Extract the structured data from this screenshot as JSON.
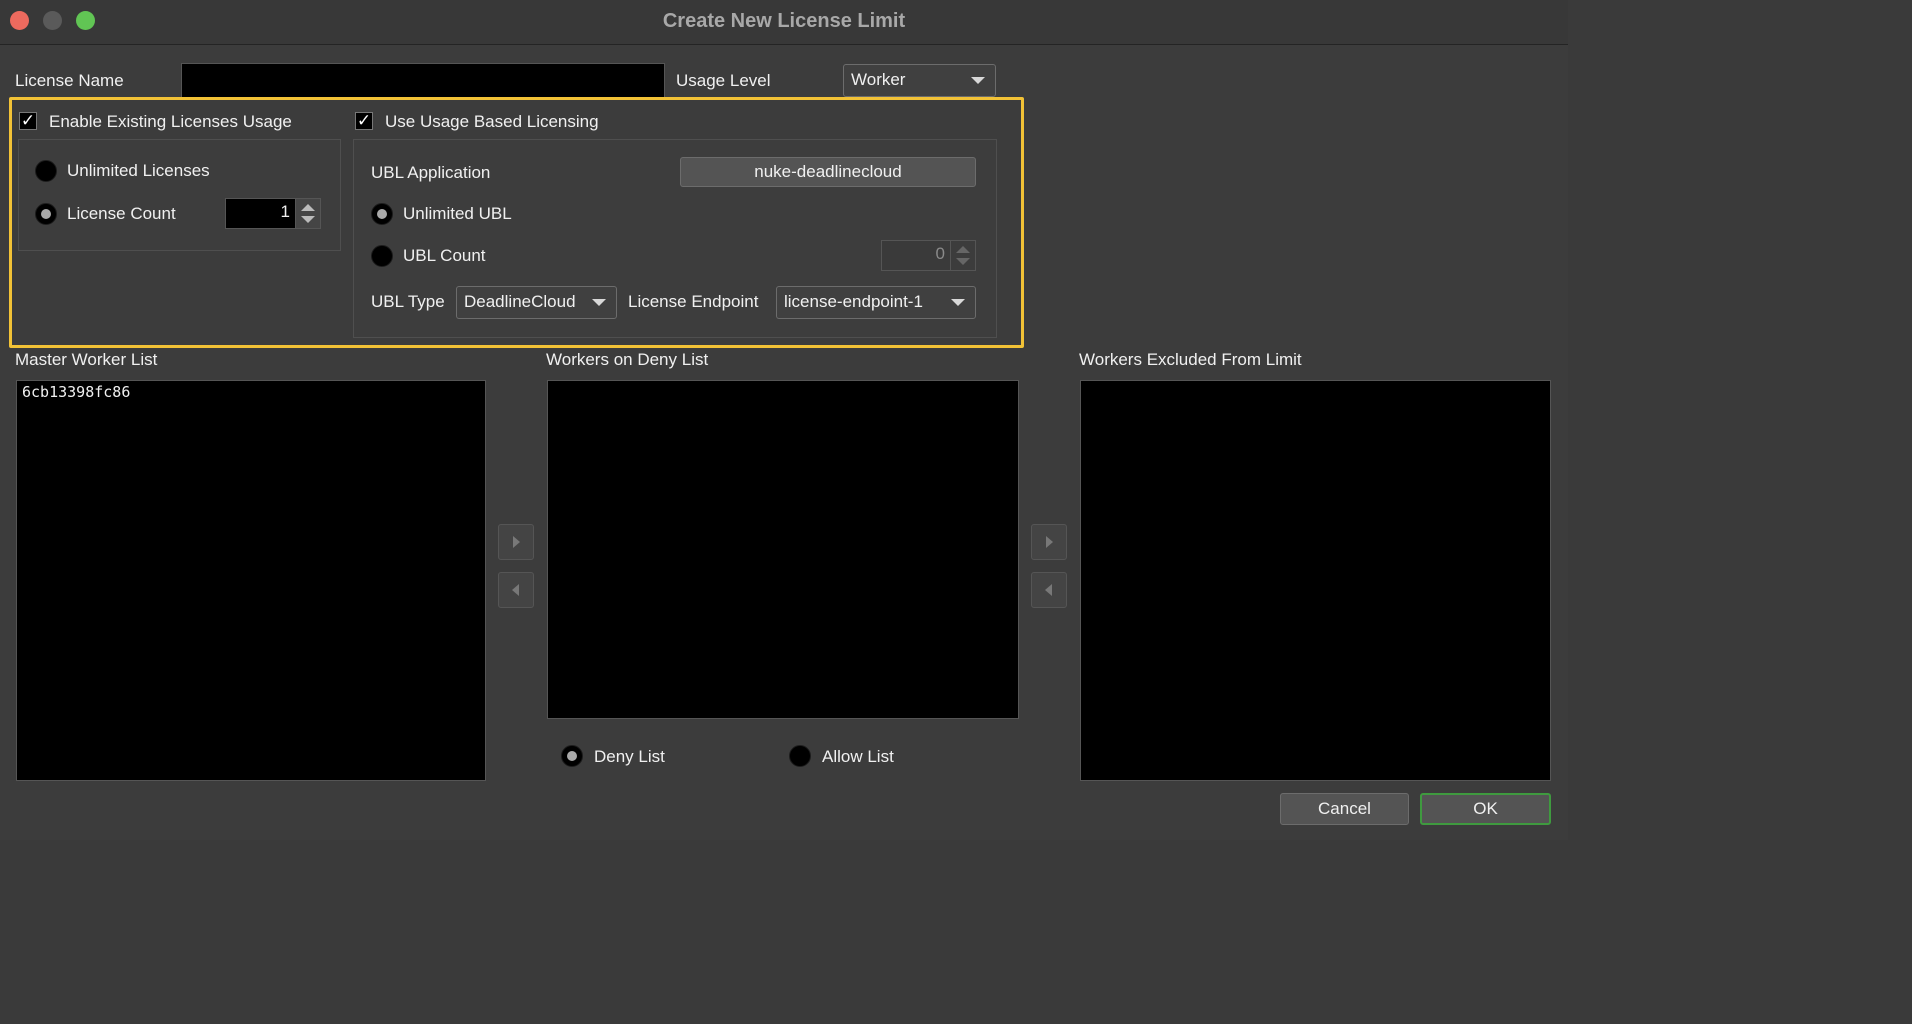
{
  "window": {
    "title": "Create New License Limit"
  },
  "form": {
    "license_name_label": "License Name",
    "license_name_value": "",
    "usage_level_label": "Usage Level",
    "usage_level_value": "Worker"
  },
  "existing_licenses": {
    "checkbox_label": "Enable Existing Licenses Usage",
    "checked": true,
    "unlimited_label": "Unlimited Licenses",
    "count_label": "License Count",
    "count_value": "1",
    "selected": "License Count"
  },
  "ubl": {
    "checkbox_label": "Use Usage Based Licensing",
    "checked": true,
    "application_label": "UBL Application",
    "application_value": "nuke-deadlinecloud",
    "unlimited_label": "Unlimited UBL",
    "count_label": "UBL Count",
    "count_value": "0",
    "selected": "Unlimited UBL",
    "type_label": "UBL Type",
    "type_value": "DeadlineCloud",
    "endpoint_label": "License Endpoint",
    "endpoint_value": "license-endpoint-1"
  },
  "lists": {
    "master_label": "Master Worker List",
    "master_items": [
      "6cb13398fc86"
    ],
    "deny_label": "Workers on Deny List",
    "deny_items": [],
    "excluded_label": "Workers Excluded From Limit",
    "excluded_items": []
  },
  "list_mode": {
    "deny_label": "Deny List",
    "allow_label": "Allow List",
    "selected": "Deny List"
  },
  "buttons": {
    "cancel": "Cancel",
    "ok": "OK"
  },
  "colors": {
    "highlight": "#f2c236",
    "ok_border": "#3f9a3f",
    "close": "#ed6a5e",
    "maximize": "#61c554"
  }
}
